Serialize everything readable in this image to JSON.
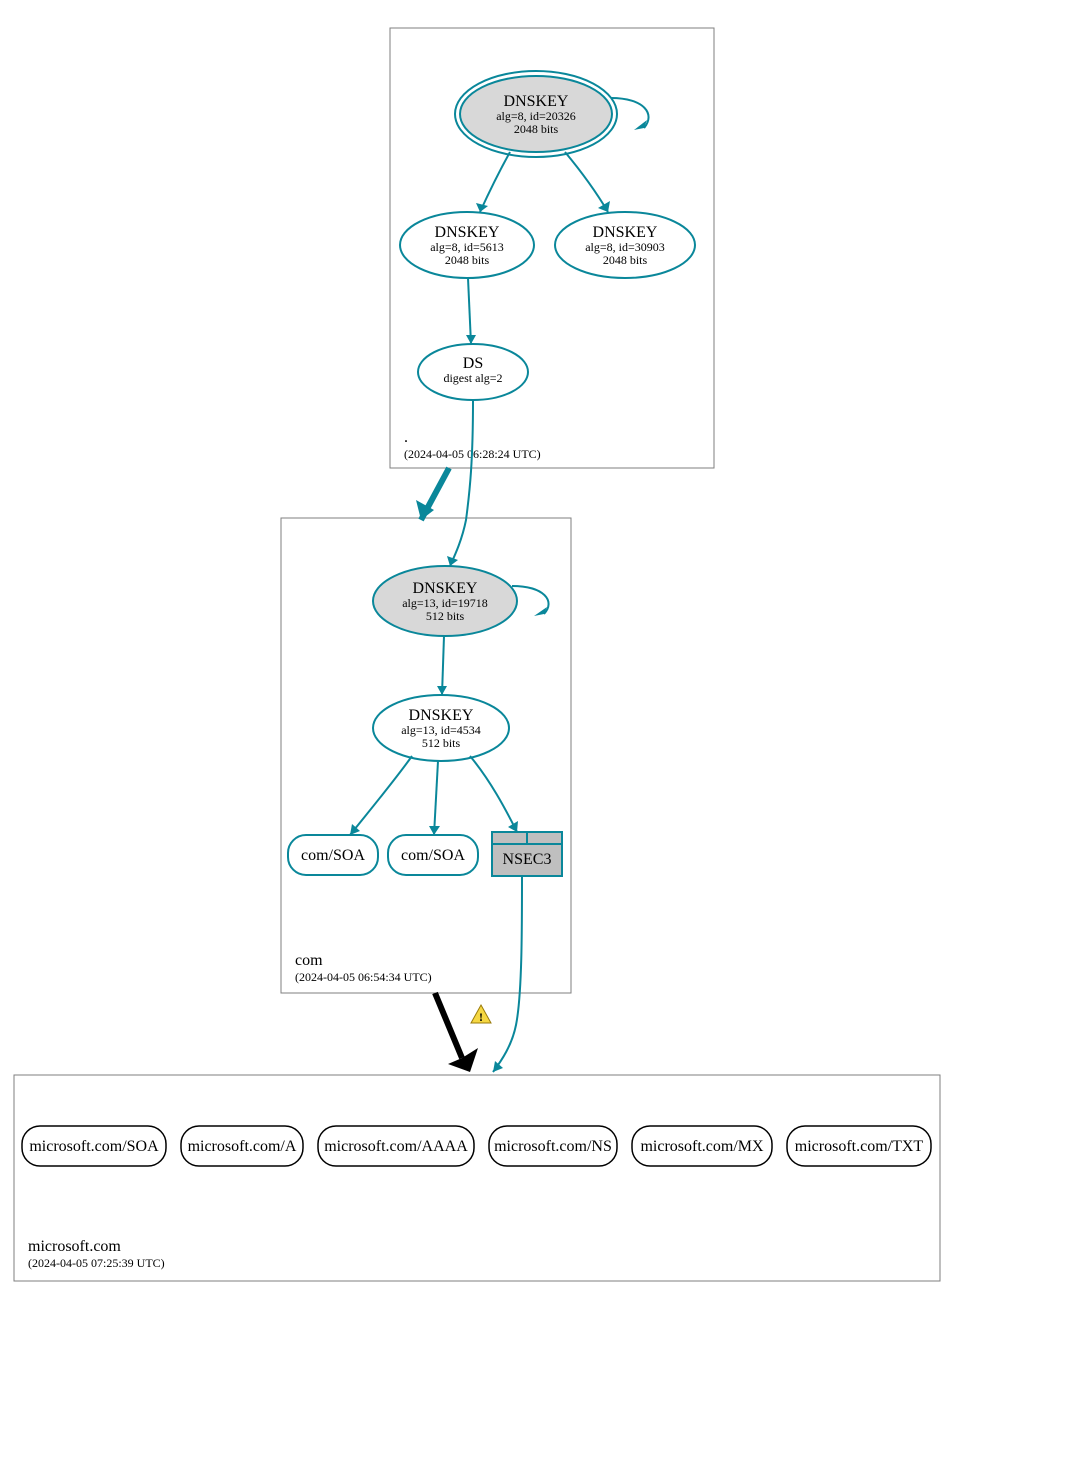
{
  "colors": {
    "teal": "#0a879a",
    "node_gray_fill": "#d8d8d8",
    "nsec3_fill": "#bfbfbf",
    "zone_border": "#7f7f7f"
  },
  "zones": {
    "root": {
      "label": ".",
      "timestamp": "(2024-04-05 06:28:24 UTC)"
    },
    "com": {
      "label": "com",
      "timestamp": "(2024-04-05 06:54:34 UTC)"
    },
    "microsoft": {
      "label": "microsoft.com",
      "timestamp": "(2024-04-05 07:25:39 UTC)"
    }
  },
  "nodes": {
    "root_ksk": {
      "title": "DNSKEY",
      "line2": "alg=8, id=20326",
      "line3": "2048 bits"
    },
    "root_zsk1": {
      "title": "DNSKEY",
      "line2": "alg=8, id=5613",
      "line3": "2048 bits"
    },
    "root_zsk2": {
      "title": "DNSKEY",
      "line2": "alg=8, id=30903",
      "line3": "2048 bits"
    },
    "root_ds": {
      "title": "DS",
      "line2": "digest alg=2"
    },
    "com_ksk": {
      "title": "DNSKEY",
      "line2": "alg=13, id=19718",
      "line3": "512 bits"
    },
    "com_zsk": {
      "title": "DNSKEY",
      "line2": "alg=13, id=4534",
      "line3": "512 bits"
    },
    "com_soa1": {
      "title": "com/SOA"
    },
    "com_soa2": {
      "title": "com/SOA"
    },
    "com_nsec3": {
      "title": "NSEC3"
    },
    "m_soa": {
      "title": "microsoft.com/SOA"
    },
    "m_a": {
      "title": "microsoft.com/A"
    },
    "m_aaaa": {
      "title": "microsoft.com/AAAA"
    },
    "m_ns": {
      "title": "microsoft.com/NS"
    },
    "m_mx": {
      "title": "microsoft.com/MX"
    },
    "m_txt": {
      "title": "microsoft.com/TXT"
    }
  },
  "warning_icon": "warning-icon"
}
